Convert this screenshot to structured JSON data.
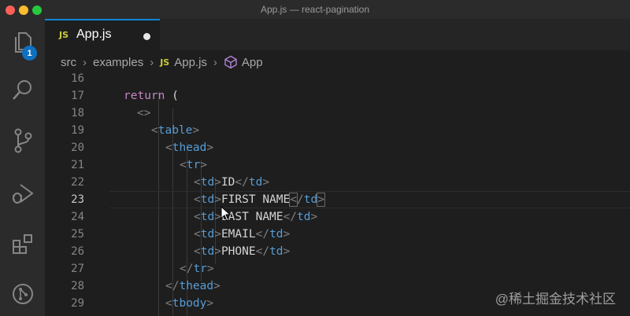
{
  "window": {
    "title": "App.js — react-pagination"
  },
  "activity_bar": {
    "explorer_badge": "1",
    "items": [
      "files-icon",
      "search-icon",
      "source-control-icon",
      "run-debug-icon",
      "extensions-icon",
      "remote-icon"
    ]
  },
  "tabs": [
    {
      "badge": "JS",
      "label": "App.js",
      "dirty": true
    }
  ],
  "breadcrumb": {
    "items": [
      "src",
      "examples",
      "App.js",
      "App"
    ],
    "file_badge": "JS"
  },
  "editor": {
    "active_line": "23",
    "lines": [
      {
        "num": "16",
        "code": ""
      },
      {
        "num": "17",
        "code": "return ("
      },
      {
        "num": "18",
        "code": "<>"
      },
      {
        "num": "19",
        "code": "<table>"
      },
      {
        "num": "20",
        "code": "<thead>"
      },
      {
        "num": "21",
        "code": "<tr>"
      },
      {
        "num": "22",
        "code": "<td>ID</td>"
      },
      {
        "num": "23",
        "code": "<td>FIRST NAME</td>"
      },
      {
        "num": "24",
        "code": "<td>LAST NAME</td>"
      },
      {
        "num": "25",
        "code": "<td>EMAIL</td>"
      },
      {
        "num": "26",
        "code": "<td>PHONE</td>"
      },
      {
        "num": "27",
        "code": "</tr>"
      },
      {
        "num": "28",
        "code": "</thead>"
      },
      {
        "num": "29",
        "code": "<tbody>"
      }
    ]
  },
  "watermark": "@稀土掘金技术社区"
}
